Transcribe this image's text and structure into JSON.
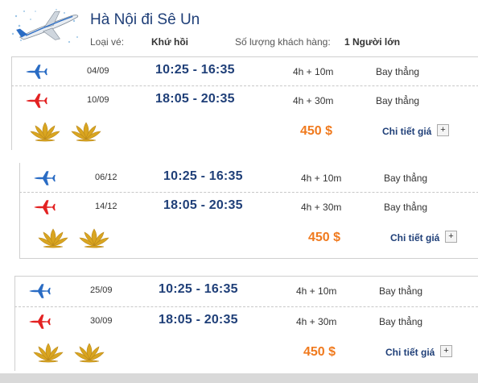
{
  "header": {
    "title": "Hà Nội đi Sê Un",
    "ticket_type_label": "Loại vé:",
    "ticket_type_value": "Khứ hồi",
    "passengers_label": "Số lượng khách hàng:",
    "passengers_value": "1 Người lớn"
  },
  "colors": {
    "outbound_plane": "#2a6cc4",
    "return_plane": "#e32222",
    "price": "#f07a1e",
    "title": "#1f3f78",
    "lotus": "#d9a520"
  },
  "options": [
    {
      "outbound": {
        "date": "04/09",
        "time": "10:25 - 16:35",
        "duration": "4h + 10m",
        "type": "Bay thẳng",
        "icon": "blue-plane-icon"
      },
      "return": {
        "date": "10/09",
        "time": "18:05 - 20:35",
        "duration": "4h + 30m",
        "type": "Bay thẳng",
        "icon": "red-plane-icon"
      },
      "price": "450 $",
      "detail_label": "Chi tiết giá",
      "expand_symbol": "+"
    },
    {
      "outbound": {
        "date": "06/12",
        "time": "10:25 - 16:35",
        "duration": "4h + 10m",
        "type": "Bay thẳng",
        "icon": "blue-plane-icon"
      },
      "return": {
        "date": "14/12",
        "time": "18:05 - 20:35",
        "duration": "4h + 30m",
        "type": "Bay thẳng",
        "icon": "red-plane-icon"
      },
      "price": "450 $",
      "detail_label": "Chi tiết giá",
      "expand_symbol": "+"
    },
    {
      "outbound": {
        "date": "25/09",
        "time": "10:25 - 16:35",
        "duration": "4h + 10m",
        "type": "Bay thẳng",
        "icon": "blue-plane-icon"
      },
      "return": {
        "date": "30/09",
        "time": "18:05 - 20:35",
        "duration": "4h + 30m",
        "type": "Bay thẳng",
        "icon": "red-plane-icon"
      },
      "price": "450 $",
      "detail_label": "Chi tiết giá",
      "expand_symbol": "+"
    }
  ]
}
